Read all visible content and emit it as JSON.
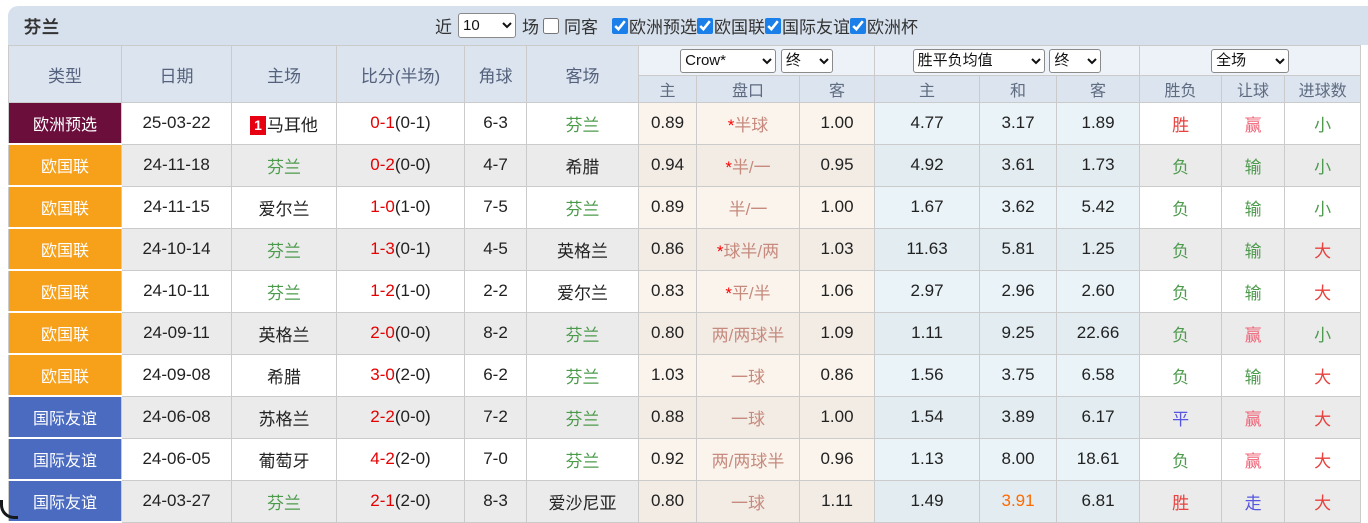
{
  "topbar": {
    "title": "芬兰",
    "recent_label": "近",
    "recent_value": "10",
    "games_label": "场",
    "same_away_label": "同客",
    "same_away_checked": false,
    "filters": [
      {
        "label": "欧洲预选",
        "checked": true
      },
      {
        "label": "欧国联",
        "checked": true
      },
      {
        "label": "国际友谊",
        "checked": true
      },
      {
        "label": "欧洲杯",
        "checked": true
      }
    ]
  },
  "colors": {
    "qual": "#6B0E3C",
    "league": "#F7A11B",
    "friendly": "#4A6BC0",
    "accent_checkbox": "#1a7fe8",
    "finland_green": "#4C9B4C",
    "score_red": "#E60000"
  },
  "table": {
    "cols": [
      "类型",
      "日期",
      "主场",
      "比分(半场)",
      "角球",
      "客场"
    ],
    "selects": {
      "crow": "Crow*",
      "crow_stage": "终",
      "avg": "胜平负均值",
      "avg_stage": "终",
      "full": "全场"
    },
    "sub": [
      "主",
      "盘口",
      "客",
      "主",
      "和",
      "客",
      "胜负",
      "让球",
      "进球数"
    ],
    "rows": [
      {
        "type": "欧洲预选",
        "type_color": "qual",
        "date": "25-03-22",
        "badge": "1",
        "home": "马耳他",
        "home_fin": false,
        "score": "0-1",
        "half": "(0-1)",
        "corners": "6-3",
        "away": "芬兰",
        "away_fin": true,
        "crow_home": "0.89",
        "handicap": "*半球",
        "crow_away": "1.00",
        "avg_home": "4.77",
        "avg_draw": "3.17",
        "avg_away": "1.89",
        "result": "胜",
        "result_color": "red",
        "handicap_result": "赢",
        "handicap_result_color": "pink",
        "goals": "小",
        "goals_color": "green"
      },
      {
        "type": "欧国联",
        "type_color": "league",
        "date": "24-11-18",
        "home": "芬兰",
        "home_fin": true,
        "score": "0-2",
        "half": "(0-0)",
        "corners": "4-7",
        "away": "希腊",
        "away_fin": false,
        "crow_home": "0.94",
        "handicap": "*半/一",
        "crow_away": "0.95",
        "avg_home": "4.92",
        "avg_draw": "3.61",
        "avg_away": "1.73",
        "result": "负",
        "result_color": "green",
        "handicap_result": "输",
        "handicap_result_color": "green",
        "goals": "小",
        "goals_color": "green"
      },
      {
        "type": "欧国联",
        "type_color": "league",
        "date": "24-11-15",
        "home": "爱尔兰",
        "home_fin": false,
        "score": "1-0",
        "half": "(1-0)",
        "corners": "7-5",
        "away": "芬兰",
        "away_fin": true,
        "crow_home": "0.89",
        "handicap": "半/一",
        "crow_away": "1.00",
        "avg_home": "1.67",
        "avg_draw": "3.62",
        "avg_away": "5.42",
        "result": "负",
        "result_color": "green",
        "handicap_result": "输",
        "handicap_result_color": "green",
        "goals": "小",
        "goals_color": "green"
      },
      {
        "type": "欧国联",
        "type_color": "league",
        "date": "24-10-14",
        "home": "芬兰",
        "home_fin": true,
        "score": "1-3",
        "half": "(0-1)",
        "corners": "4-5",
        "away": "英格兰",
        "away_fin": false,
        "crow_home": "0.86",
        "handicap": "*球半/两",
        "crow_away": "1.03",
        "avg_home": "11.63",
        "avg_draw": "5.81",
        "avg_away": "1.25",
        "result": "负",
        "result_color": "green",
        "handicap_result": "输",
        "handicap_result_color": "green",
        "goals": "大",
        "goals_color": "red"
      },
      {
        "type": "欧国联",
        "type_color": "league",
        "date": "24-10-11",
        "home": "芬兰",
        "home_fin": true,
        "score": "1-2",
        "half": "(1-0)",
        "corners": "2-2",
        "away": "爱尔兰",
        "away_fin": false,
        "crow_home": "0.83",
        "handicap": "*平/半",
        "crow_away": "1.06",
        "avg_home": "2.97",
        "avg_draw": "2.96",
        "avg_away": "2.60",
        "result": "负",
        "result_color": "green",
        "handicap_result": "输",
        "handicap_result_color": "green",
        "goals": "大",
        "goals_color": "red"
      },
      {
        "type": "欧国联",
        "type_color": "league",
        "date": "24-09-11",
        "home": "英格兰",
        "home_fin": false,
        "score": "2-0",
        "half": "(0-0)",
        "corners": "8-2",
        "away": "芬兰",
        "away_fin": true,
        "crow_home": "0.80",
        "handicap": "两/两球半",
        "crow_away": "1.09",
        "avg_home": "1.11",
        "avg_draw": "9.25",
        "avg_away": "22.66",
        "result": "负",
        "result_color": "green",
        "handicap_result": "赢",
        "handicap_result_color": "pink",
        "goals": "小",
        "goals_color": "green"
      },
      {
        "type": "欧国联",
        "type_color": "league",
        "date": "24-09-08",
        "home": "希腊",
        "home_fin": false,
        "score": "3-0",
        "half": "(2-0)",
        "corners": "6-2",
        "away": "芬兰",
        "away_fin": true,
        "crow_home": "1.03",
        "handicap": "一球",
        "crow_away": "0.86",
        "avg_home": "1.56",
        "avg_draw": "3.75",
        "avg_away": "6.58",
        "result": "负",
        "result_color": "green",
        "handicap_result": "输",
        "handicap_result_color": "green",
        "goals": "大",
        "goals_color": "red"
      },
      {
        "type": "国际友谊",
        "type_color": "friendly",
        "date": "24-06-08",
        "home": "苏格兰",
        "home_fin": false,
        "score": "2-2",
        "half": "(0-0)",
        "corners": "7-2",
        "away": "芬兰",
        "away_fin": true,
        "crow_home": "0.88",
        "handicap": "一球",
        "crow_away": "1.00",
        "avg_home": "1.54",
        "avg_draw": "3.89",
        "avg_away": "6.17",
        "result": "平",
        "result_color": "blue",
        "handicap_result": "赢",
        "handicap_result_color": "pink",
        "goals": "大",
        "goals_color": "red"
      },
      {
        "type": "国际友谊",
        "type_color": "friendly",
        "date": "24-06-05",
        "home": "葡萄牙",
        "home_fin": false,
        "score": "4-2",
        "half": "(2-0)",
        "corners": "7-0",
        "away": "芬兰",
        "away_fin": true,
        "crow_home": "0.92",
        "handicap": "两/两球半",
        "crow_away": "0.96",
        "avg_home": "1.13",
        "avg_draw": "8.00",
        "avg_away": "18.61",
        "result": "负",
        "result_color": "green",
        "handicap_result": "赢",
        "handicap_result_color": "pink",
        "goals": "大",
        "goals_color": "red"
      },
      {
        "type": "国际友谊",
        "type_color": "friendly",
        "date": "24-03-27",
        "home": "芬兰",
        "home_fin": true,
        "score": "2-1",
        "half": "(2-0)",
        "corners": "8-3",
        "away": "爱沙尼亚",
        "away_fin": false,
        "crow_home": "0.80",
        "handicap": "一球",
        "crow_away": "1.11",
        "avg_home": "1.49",
        "avg_draw": "3.91",
        "avg_draw_color": "orange",
        "avg_away": "6.81",
        "result": "胜",
        "result_color": "red",
        "handicap_result": "走",
        "handicap_result_color": "blue",
        "goals": "大",
        "goals_color": "red"
      }
    ]
  }
}
